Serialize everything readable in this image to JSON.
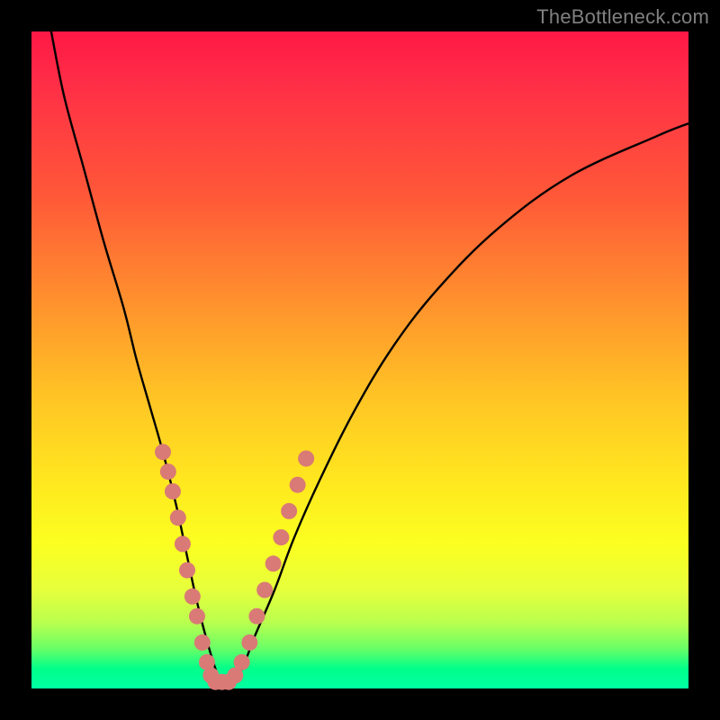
{
  "watermark": "TheBottleneck.com",
  "chart_data": {
    "type": "line",
    "title": "",
    "xlabel": "",
    "ylabel": "",
    "xlim": [
      0,
      100
    ],
    "ylim": [
      0,
      100
    ],
    "grid": false,
    "legend": false,
    "background_gradient": {
      "orientation": "vertical",
      "stops": [
        {
          "pos": 0.0,
          "color": "#ff1846"
        },
        {
          "pos": 0.25,
          "color": "#ff5838"
        },
        {
          "pos": 0.55,
          "color": "#ffc225"
        },
        {
          "pos": 0.78,
          "color": "#fbff20"
        },
        {
          "pos": 0.94,
          "color": "#67ff66"
        },
        {
          "pos": 1.0,
          "color": "#00ffa2"
        }
      ]
    },
    "series": [
      {
        "name": "bottleneck-curve",
        "x": [
          3,
          5,
          8,
          11,
          14,
          16,
          18,
          20,
          22,
          23.5,
          25,
          26.5,
          28,
          29,
          30,
          32,
          34,
          37,
          40,
          44,
          49,
          55,
          62,
          71,
          82,
          95,
          100
        ],
        "y": [
          100,
          90,
          79,
          68,
          58,
          50,
          43,
          36,
          28,
          21,
          14,
          8,
          3,
          1,
          1,
          3,
          8,
          15,
          23,
          32,
          42,
          52,
          61,
          70,
          78,
          84,
          86
        ]
      }
    ],
    "markers": {
      "name": "highlight-dots",
      "color": "#d97a76",
      "radius_px": 9,
      "points": [
        {
          "x": 20.0,
          "y": 36
        },
        {
          "x": 20.8,
          "y": 33
        },
        {
          "x": 21.5,
          "y": 30
        },
        {
          "x": 22.3,
          "y": 26
        },
        {
          "x": 23.0,
          "y": 22
        },
        {
          "x": 23.7,
          "y": 18
        },
        {
          "x": 24.5,
          "y": 14
        },
        {
          "x": 25.2,
          "y": 11
        },
        {
          "x": 26.0,
          "y": 7
        },
        {
          "x": 26.7,
          "y": 4
        },
        {
          "x": 27.3,
          "y": 2
        },
        {
          "x": 28.0,
          "y": 1
        },
        {
          "x": 29.0,
          "y": 1
        },
        {
          "x": 30.0,
          "y": 1
        },
        {
          "x": 31.0,
          "y": 2
        },
        {
          "x": 32.0,
          "y": 4
        },
        {
          "x": 33.2,
          "y": 7
        },
        {
          "x": 34.3,
          "y": 11
        },
        {
          "x": 35.5,
          "y": 15
        },
        {
          "x": 36.8,
          "y": 19
        },
        {
          "x": 38.0,
          "y": 23
        },
        {
          "x": 39.2,
          "y": 27
        },
        {
          "x": 40.5,
          "y": 31
        },
        {
          "x": 41.8,
          "y": 35
        }
      ]
    }
  }
}
